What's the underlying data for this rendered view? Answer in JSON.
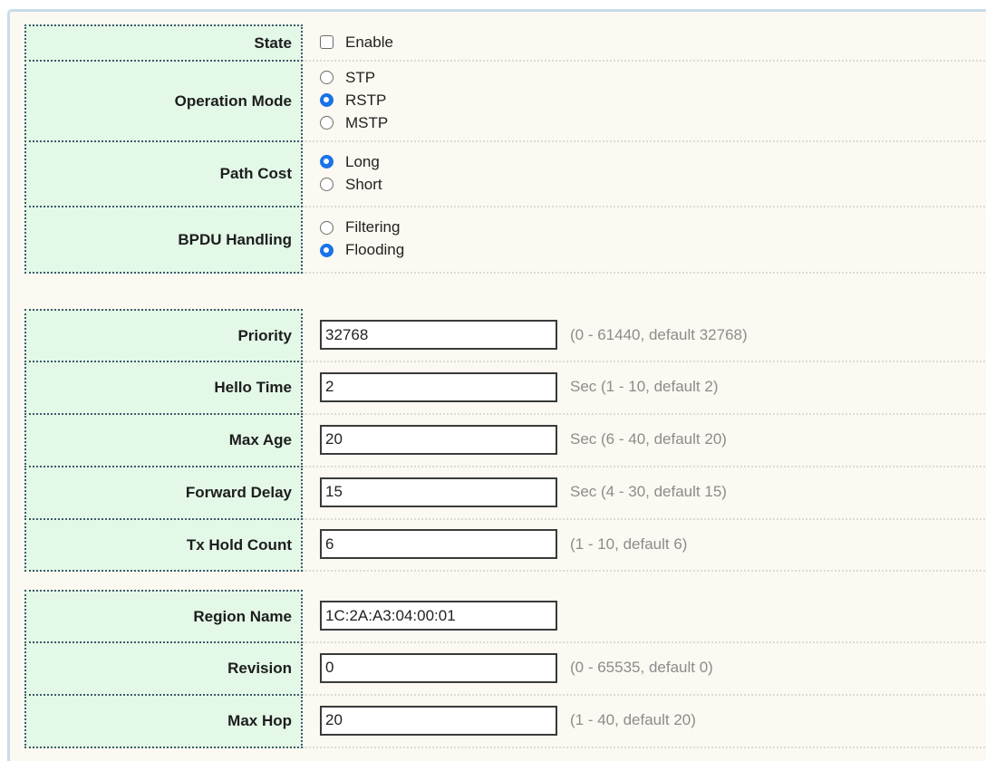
{
  "global": {
    "state": {
      "label": "State",
      "checkbox_text": "Enable",
      "checked": false
    },
    "operation_mode": {
      "label": "Operation Mode",
      "options": [
        "STP",
        "RSTP",
        "MSTP"
      ],
      "selected": "RSTP"
    },
    "path_cost": {
      "label": "Path Cost",
      "options": [
        "Long",
        "Short"
      ],
      "selected": "Long"
    },
    "bpdu_handling": {
      "label": "BPDU Handling",
      "options": [
        "Filtering",
        "Flooding"
      ],
      "selected": "Flooding"
    }
  },
  "bridge": {
    "priority": {
      "label": "Priority",
      "value": "32768",
      "hint": "(0 - 61440, default 32768)"
    },
    "hello_time": {
      "label": "Hello Time",
      "value": "2",
      "hint": "Sec (1 - 10, default 2)"
    },
    "max_age": {
      "label": "Max Age",
      "value": "20",
      "hint": "Sec (6 - 40, default 20)"
    },
    "forward_delay": {
      "label": "Forward Delay",
      "value": "15",
      "hint": "Sec (4 - 30, default 15)"
    },
    "tx_hold_count": {
      "label": "Tx Hold Count",
      "value": "6",
      "hint": "(1 - 10, default 6)"
    }
  },
  "mstp": {
    "region_name": {
      "label": "Region Name",
      "value": "1C:2A:A3:04:00:01"
    },
    "revision": {
      "label": "Revision",
      "value": "0",
      "hint": "(0 - 65535, default 0)"
    },
    "max_hop": {
      "label": "Max Hop",
      "value": "20",
      "hint": "(1 - 40, default 20)"
    }
  },
  "colors": {
    "label_bg": "#e3f8e7",
    "panel_bg": "#fbf9f1",
    "radio_accent": "#1a73e8",
    "hint_text": "#8c8c8c"
  }
}
